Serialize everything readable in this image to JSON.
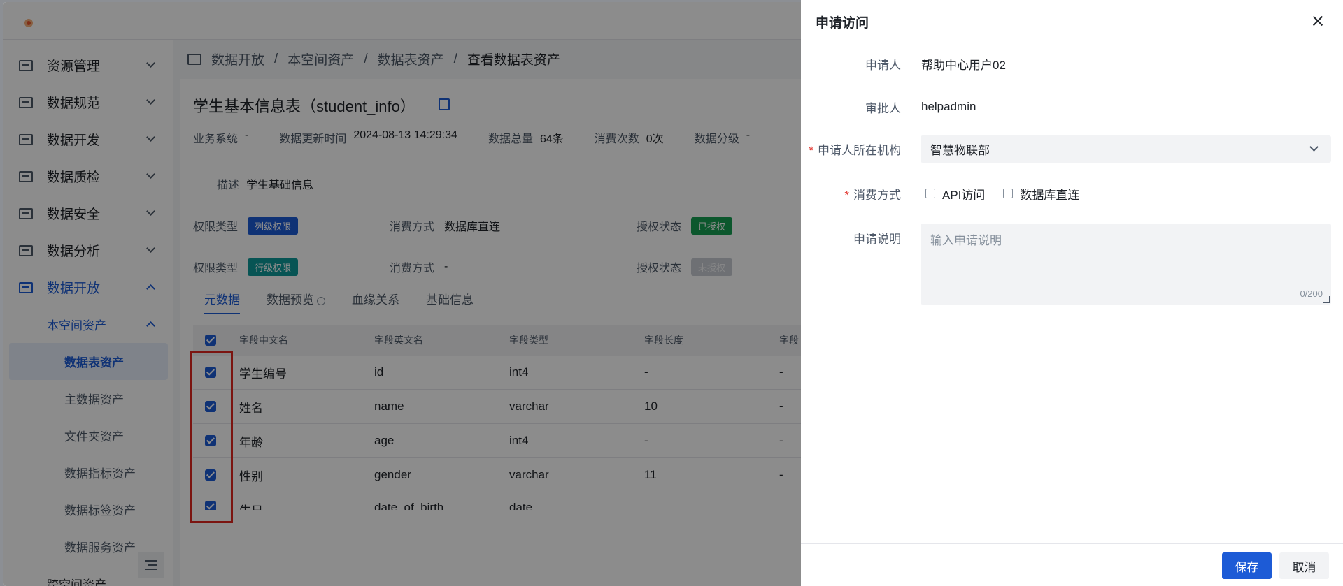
{
  "breadcrumb": [
    "数据开放",
    "本空间资产",
    "数据表资产",
    "查看数据表资产"
  ],
  "sidebar": {
    "items": [
      {
        "label": "资源管理"
      },
      {
        "label": "数据规范"
      },
      {
        "label": "数据开发"
      },
      {
        "label": "数据质检"
      },
      {
        "label": "数据安全"
      },
      {
        "label": "数据分析"
      },
      {
        "label": "数据开放"
      }
    ],
    "sub_group": "本空间资产",
    "sub_items": [
      "数据表资产",
      "主数据资产",
      "文件夹资产",
      "数据指标资产",
      "数据标签资产",
      "数据服务资产"
    ],
    "next_group": "跨空间资产"
  },
  "asset": {
    "title": "学生基本信息表（student_info）",
    "meta": [
      {
        "label": "业务系统",
        "value": "-"
      },
      {
        "label": "数据更新时间",
        "value": "2024-08-13 14:29:34"
      },
      {
        "label": "数据总量",
        "value": "64条"
      },
      {
        "label": "消费次数",
        "value": "0次"
      },
      {
        "label": "数据分级",
        "value": "-"
      }
    ],
    "desc_label": "描述",
    "desc_value": "学生基础信息",
    "permissions": [
      {
        "type_label": "权限类型",
        "type_tag": "列级权限",
        "consume_label": "消费方式",
        "consume_value": "数据库直连",
        "auth_label": "授权状态",
        "auth_tag": "已授权"
      },
      {
        "type_label": "权限类型",
        "type_tag": "行级权限",
        "consume_label": "消费方式",
        "consume_value": "-",
        "auth_label": "授权状态",
        "auth_tag": "未授权"
      }
    ]
  },
  "tabs": [
    "元数据",
    "数据预览",
    "血缘关系",
    "基础信息"
  ],
  "table": {
    "headers": [
      "字段中文名",
      "字段英文名",
      "字段类型",
      "字段长度",
      "字段"
    ],
    "rows": [
      [
        "学生编号",
        "id",
        "int4",
        "-",
        "-"
      ],
      [
        "姓名",
        "name",
        "varchar",
        "10",
        "-"
      ],
      [
        "年龄",
        "age",
        "int4",
        "-",
        "-"
      ],
      [
        "性别",
        "gender",
        "varchar",
        "11",
        "-"
      ],
      [
        "生日",
        "date_of_birth",
        "date",
        "",
        ""
      ]
    ]
  },
  "drawer": {
    "title": "申请访问",
    "applicant_label": "申请人",
    "applicant_value": "帮助中心用户02",
    "approver_label": "审批人",
    "approver_value": "helpadmin",
    "org_label": "申请人所在机构",
    "org_value": "智慧物联部",
    "consume_label": "消费方式",
    "consume_options": [
      "API访问",
      "数据库直连"
    ],
    "note_label": "申请说明",
    "note_placeholder": "输入申请说明",
    "note_counter": "0/200",
    "save_label": "保存",
    "cancel_label": "取消"
  },
  "colors": {
    "accent": "#1d5bd6",
    "highlight_box": "#e0261e"
  }
}
